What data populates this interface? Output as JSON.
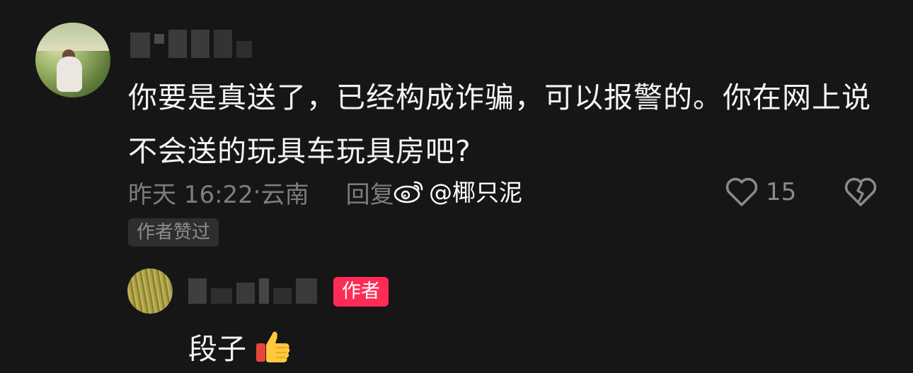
{
  "comment": {
    "text": "你要是真送了，已经构成诈骗，可以报警的。你在网上说不会送的玩具车玩具房吧?",
    "time": "昨天 16:22",
    "separator": "·",
    "location": "云南",
    "reply_label": "回复",
    "like_count": "15",
    "author_liked_tag": "作者赞过",
    "icons": {
      "like": "heart-outline-icon",
      "dislike": "broken-heart-icon"
    }
  },
  "watermark": {
    "text": "@椰只泥",
    "icon": "weibo-icon"
  },
  "reply": {
    "badge": "作者",
    "text": "段子",
    "emoji": "thumbs-up-emoji",
    "badge_color": "#fe2c55"
  }
}
